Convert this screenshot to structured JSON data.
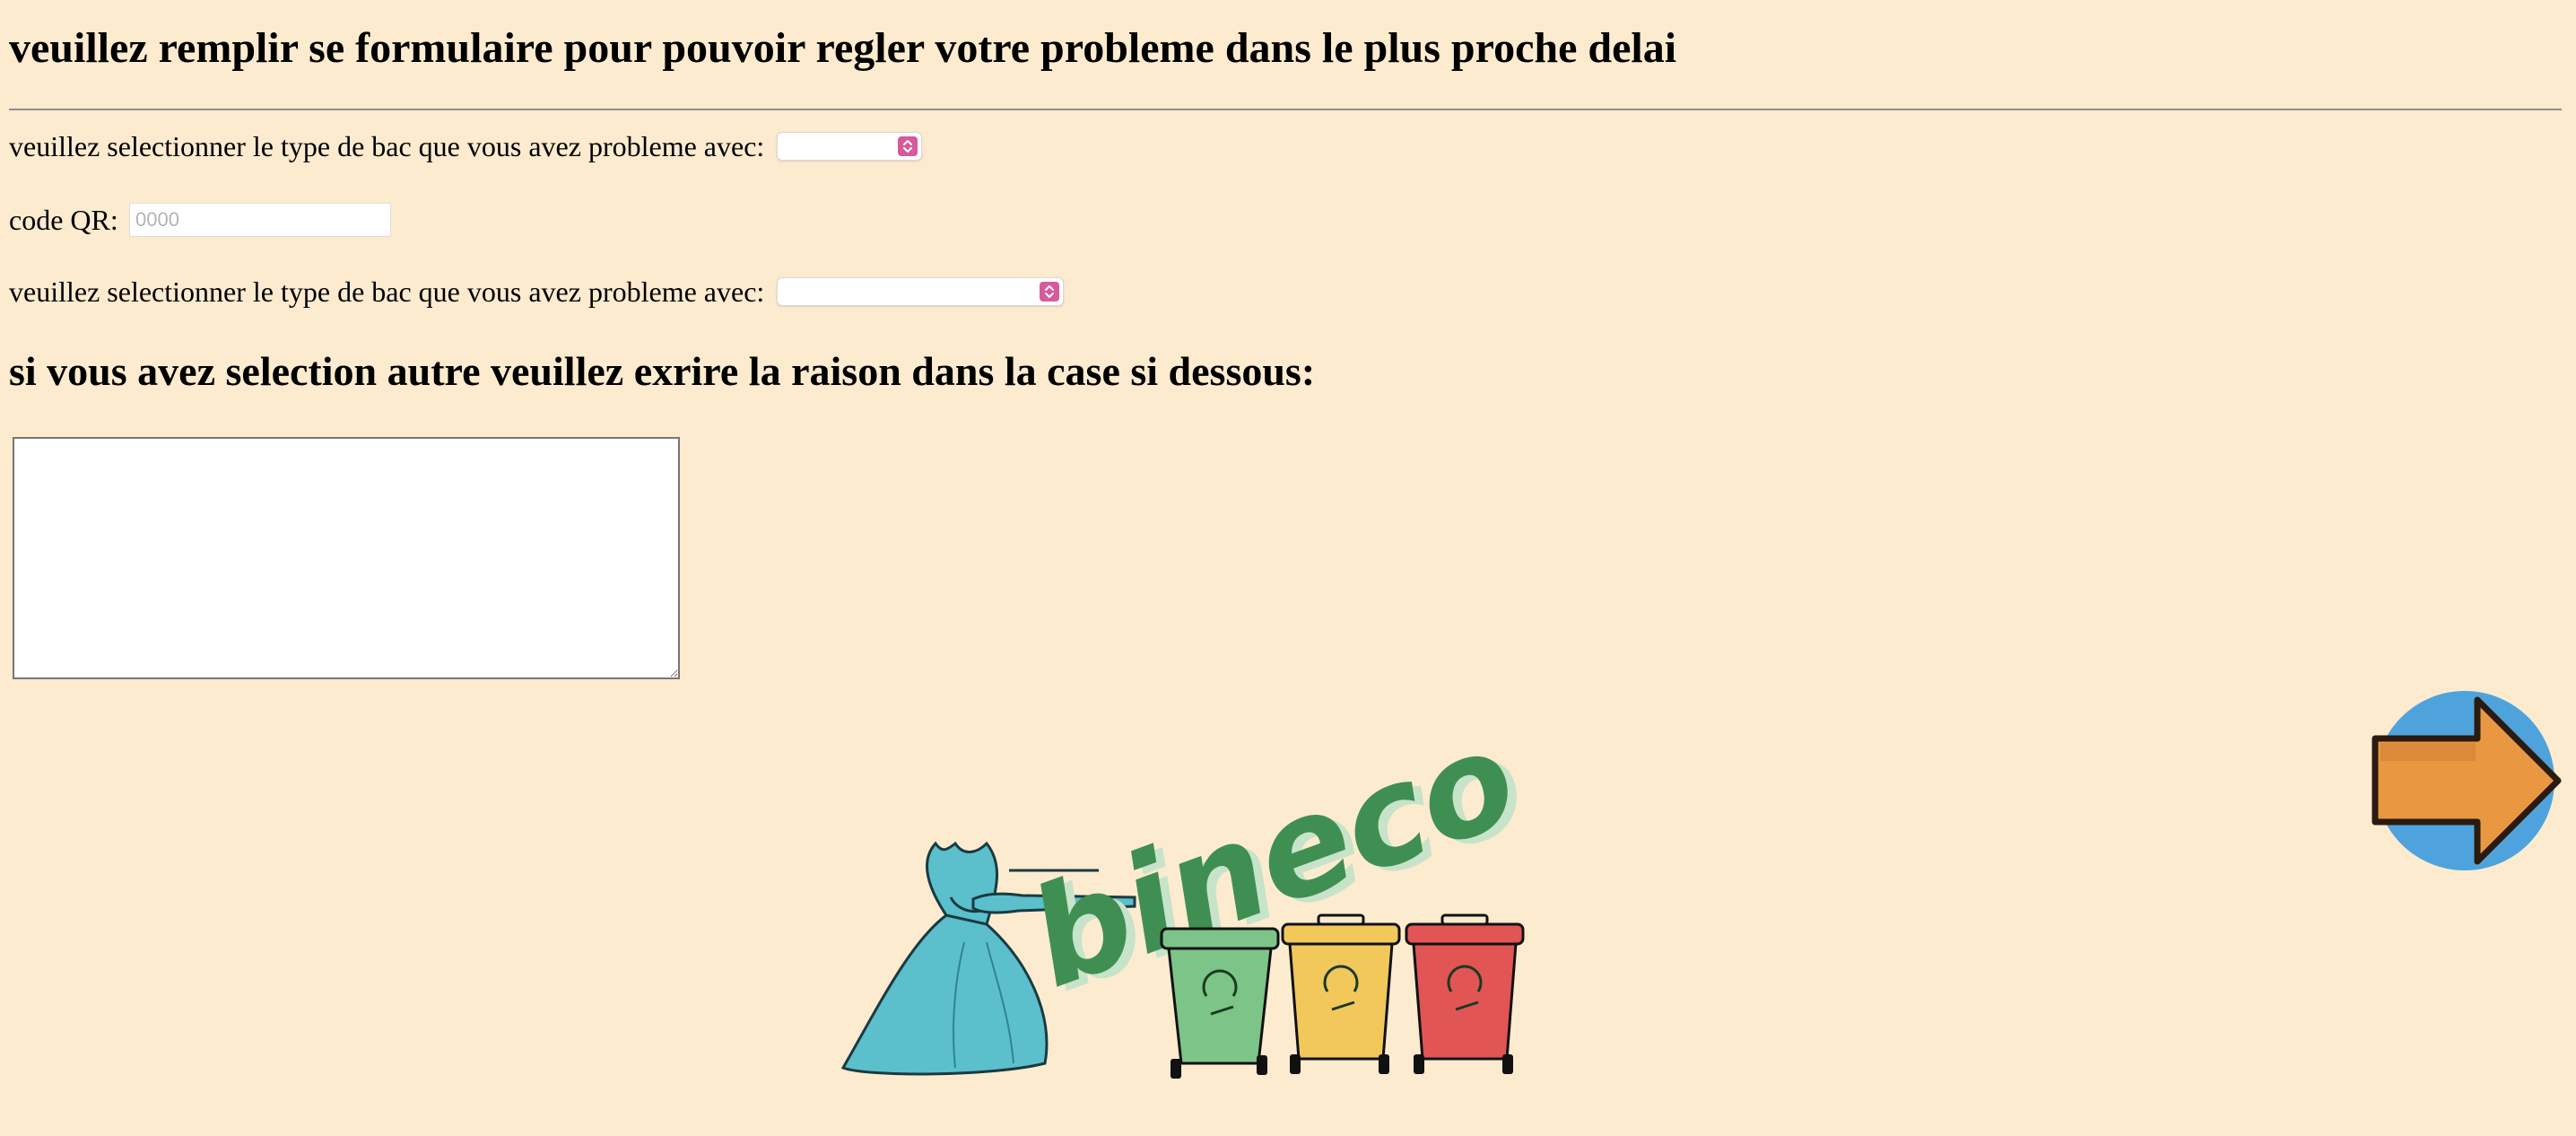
{
  "header": {
    "title": "veuillez remplir se formulaire pour pouvoir regler votre probleme dans le plus proche delai"
  },
  "form": {
    "bin_type_label": "veuillez selectionner le type de bac que vous avez probleme avec:",
    "bin_type_value": "",
    "qr_label": "code QR:",
    "qr_placeholder": "0000",
    "qr_value": "",
    "problem_type_label": "veuillez selectionner le type de bac que vous avez probleme avec:",
    "problem_type_value": "",
    "other_reason_heading": "si vous avez selection autre veuillez exrire la raison dans la case si dessous:",
    "reason_value": ""
  },
  "branding": {
    "logo_text": "bineco",
    "logo_color": "#3f8f52",
    "bag_color": "#5bbfcc",
    "bin_colors": [
      "#7cc487",
      "#f2c85b",
      "#e15555"
    ]
  },
  "navigation": {
    "next_icon": "arrow-right-icon",
    "circle_color": "#4fa3dc",
    "arrow_color": "#ea9742"
  },
  "theme": {
    "background": "#fcebcf",
    "select_accent": "#d75a9c"
  }
}
